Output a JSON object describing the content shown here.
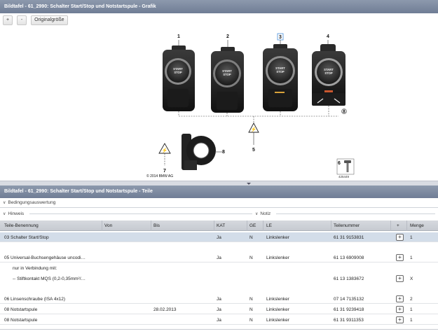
{
  "window": {
    "graphic_title": "Bildtafel - 61_2990: Schalter Start/Stop und Notstartspule - Grafik",
    "parts_title": "Bildtafel - 61_2990: Schalter Start/Stop und Notstartspule - Teile"
  },
  "toolbar": {
    "zoom_in": "+",
    "zoom_out": "-",
    "original_size": "Originalgröße"
  },
  "graphic": {
    "callouts": [
      "1",
      "2",
      "3",
      "4",
      "5",
      "6",
      "7",
      "8",
      "8"
    ],
    "button_text": [
      "START",
      "STOP"
    ],
    "copyright": "© 2014 BMW AG",
    "figure_id": "425449",
    "highlight_color": "#4a90d9"
  },
  "filters": {
    "conditions": "Bedingungsauswertung",
    "hint": "Hinweis",
    "note": "Notiz"
  },
  "table": {
    "columns": [
      "Teile-Benennung",
      "Von",
      "Bis",
      "KAT",
      "GE",
      "LE",
      "Teilenummer",
      "+",
      "Menge"
    ],
    "rows": [
      {
        "name": "03 Schalter Start/Stop",
        "von": "",
        "bis": "",
        "kat": "Ja",
        "ge": "N",
        "le": "Linkslenker",
        "partno": "61 31 9153831",
        "qty": "1",
        "cart": true,
        "selected": true
      },
      {
        "name": "05 Universal-Buchsengehäuse uncodi…",
        "von": "",
        "bis": "",
        "kat": "Ja",
        "ge": "N",
        "le": "Linkslenker",
        "partno": "61 13 6909008",
        "qty": "1",
        "cart": true
      },
      {
        "name": "nur in Verbindung mit:",
        "von": "",
        "bis": "",
        "kat": "",
        "ge": "",
        "le": "",
        "partno": "",
        "qty": "",
        "cart": false,
        "indent": true
      },
      {
        "name": "-- Stiftkontakt MQS (0,2-0,35mm²/…",
        "von": "",
        "bis": "",
        "kat": "",
        "ge": "",
        "le": "",
        "partno": "61 13 1383672",
        "qty": "X",
        "cart": true,
        "indent": true
      },
      {
        "name": "06 Linsenschraube (ISA 4x12)",
        "von": "",
        "bis": "",
        "kat": "Ja",
        "ge": "N",
        "le": "Linkslenker",
        "partno": "07 14 7135132",
        "qty": "2",
        "cart": true
      },
      {
        "name": "08 Notstartspule",
        "von": "",
        "bis": "28.02.2013",
        "kat": "Ja",
        "ge": "N",
        "le": "Linkslenker",
        "partno": "61 31 9239418",
        "qty": "1",
        "cart": true
      },
      {
        "name": "08 Notstartspule",
        "von": "",
        "bis": "",
        "kat": "Ja",
        "ge": "N",
        "le": "Linkslenker",
        "partno": "61 31 9311353",
        "qty": "1",
        "cart": true
      }
    ]
  }
}
